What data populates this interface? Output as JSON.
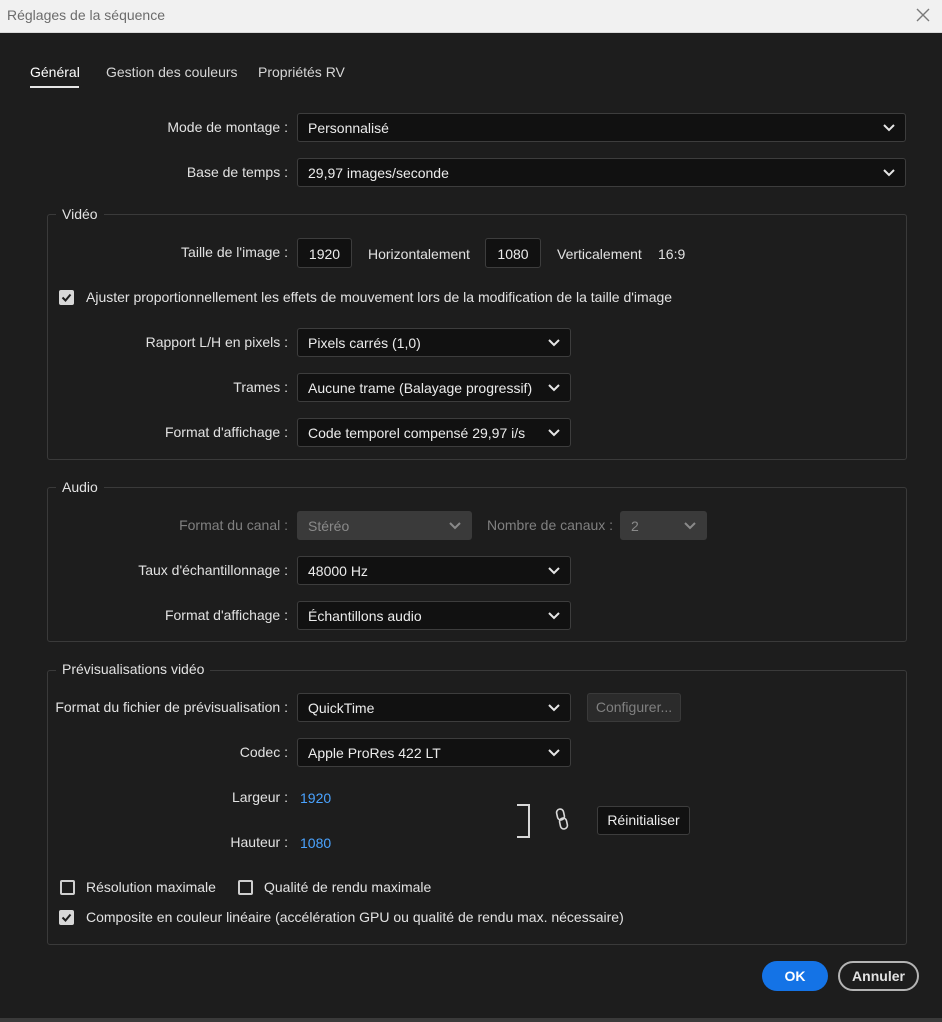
{
  "window": {
    "title": "Réglages de la séquence"
  },
  "tabs": [
    {
      "label": "Général",
      "active": true
    },
    {
      "label": "Gestion des couleurs",
      "active": false
    },
    {
      "label": "Propriétés RV",
      "active": false
    }
  ],
  "general": {
    "editing_mode": {
      "label": "Mode de montage :",
      "value": "Personnalisé"
    },
    "timebase": {
      "label": "Base de temps :",
      "value": "29,97  images/seconde"
    }
  },
  "video": {
    "legend": "Vidéo",
    "frame_size": {
      "label": "Taille de l'image :",
      "width": "1920",
      "horizontal_label": "Horizontalement",
      "height": "1080",
      "vertical_label": "Verticalement",
      "aspect": "16:9"
    },
    "scale_checkbox": {
      "label": "Ajuster proportionnellement les effets de mouvement lors de la modification de la taille d'image",
      "checked": true
    },
    "pixel_aspect": {
      "label": "Rapport L/H en pixels :",
      "value": "Pixels carrés (1,0)"
    },
    "fields": {
      "label": "Trames :",
      "value": "Aucune trame (Balayage progressif)"
    },
    "display_format": {
      "label": "Format d'affichage :",
      "value": "Code temporel compensé 29,97 i/s"
    }
  },
  "audio": {
    "legend": "Audio",
    "channel_format": {
      "label": "Format du canal :",
      "value": "Stéréo",
      "disabled": true
    },
    "num_channels": {
      "label": "Nombre de canaux :",
      "value": "2",
      "disabled": true
    },
    "sample_rate": {
      "label": "Taux d'échantillonnage :",
      "value": "48000 Hz"
    },
    "display_format": {
      "label": "Format d'affichage :",
      "value": "Échantillons audio"
    }
  },
  "previews": {
    "legend": "Prévisualisations vidéo",
    "file_format": {
      "label": "Format du fichier de prévisualisation :",
      "value": "QuickTime"
    },
    "configure_button": "Configurer...",
    "codec": {
      "label": "Codec :",
      "value": "Apple ProRes 422 LT"
    },
    "width": {
      "label": "Largeur :",
      "value": "1920"
    },
    "height": {
      "label": "Hauteur :",
      "value": "1080"
    },
    "reset_button": "Réinitialiser",
    "max_bit_depth": {
      "label": "Résolution maximale",
      "checked": false
    },
    "max_render_quality": {
      "label": "Qualité de rendu maximale",
      "checked": false
    },
    "linear_color": {
      "label": "Composite en couleur linéaire (accélération GPU ou qualité de rendu max. nécessaire)",
      "checked": true
    }
  },
  "footer": {
    "ok": "OK",
    "cancel": "Annuler"
  },
  "colors": {
    "accent": "#1473e6",
    "link_value": "#4aa3ff",
    "background": "#1d1d1d",
    "field_bg": "#111111"
  }
}
